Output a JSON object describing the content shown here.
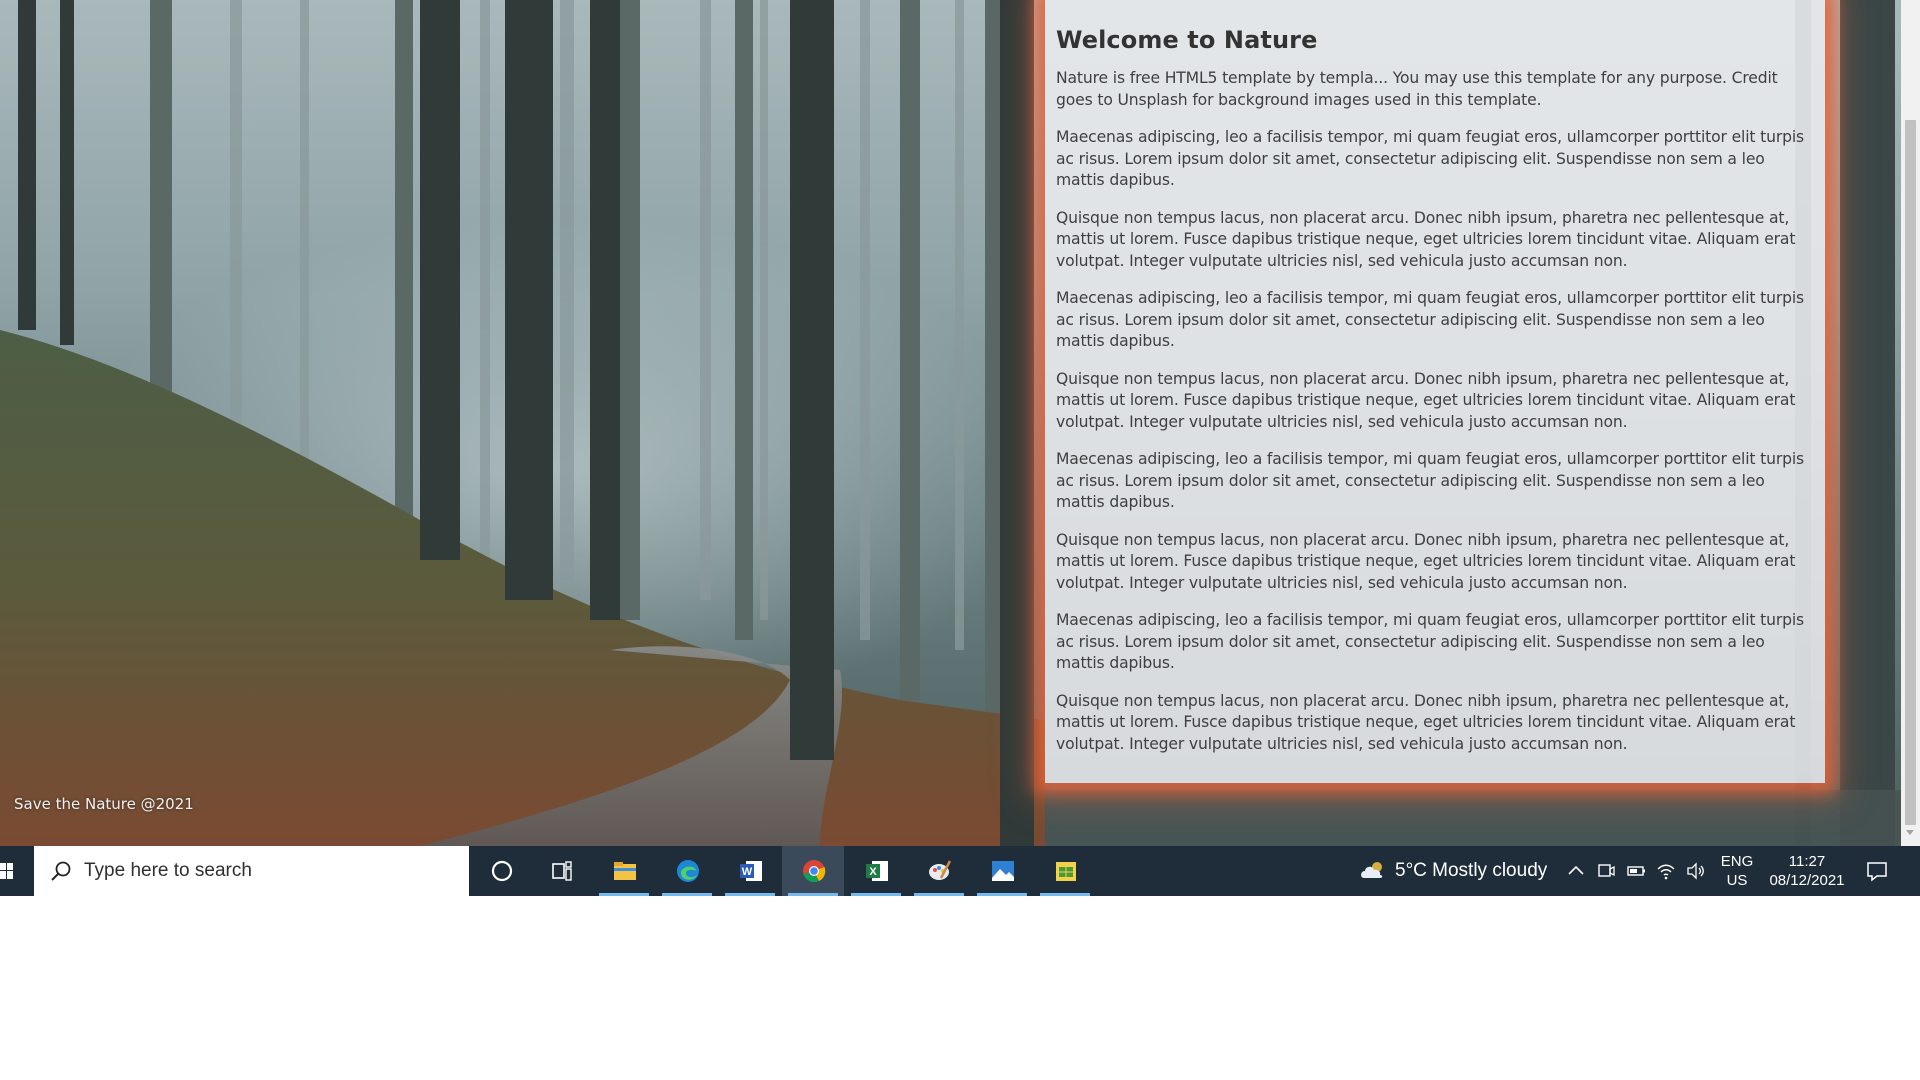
{
  "page": {
    "title": "Welcome to Nature",
    "paragraphs": [
      "Nature is free HTML5 template by templa... You may use this template for any purpose. Credit goes to Unsplash for background images used in this template.",
      "Maecenas adipiscing, leo a facilisis tempor, mi quam feugiat eros, ullamcorper porttitor elit turpis ac risus. Lorem ipsum dolor sit amet, consectetur adipiscing elit. Suspendisse non sem a leo mattis dapibus.",
      "Quisque non tempus lacus, non placerat arcu. Donec nibh ipsum, pharetra nec pellentesque at, mattis ut lorem. Fusce dapibus tristique neque, eget ultricies lorem tincidunt vitae. Aliquam erat volutpat. Integer vulputate ultricies nisl, sed vehicula justo accumsan non.",
      "Maecenas adipiscing, leo a facilisis tempor, mi quam feugiat eros, ullamcorper porttitor elit turpis ac risus. Lorem ipsum dolor sit amet, consectetur adipiscing elit. Suspendisse non sem a leo mattis dapibus.",
      "Quisque non tempus lacus, non placerat arcu. Donec nibh ipsum, pharetra nec pellentesque at, mattis ut lorem. Fusce dapibus tristique neque, eget ultricies lorem tincidunt vitae. Aliquam erat volutpat. Integer vulputate ultricies nisl, sed vehicula justo accumsan non.",
      "Maecenas adipiscing, leo a facilisis tempor, mi quam feugiat eros, ullamcorper porttitor elit turpis ac risus. Lorem ipsum dolor sit amet, consectetur adipiscing elit. Suspendisse non sem a leo mattis dapibus.",
      "Quisque non tempus lacus, non placerat arcu. Donec nibh ipsum, pharetra nec pellentesque at, mattis ut lorem. Fusce dapibus tristique neque, eget ultricies lorem tincidunt vitae. Aliquam erat volutpat. Integer vulputate ultricies nisl, sed vehicula justo accumsan non.",
      "Maecenas adipiscing, leo a facilisis tempor, mi quam feugiat eros, ullamcorper porttitor elit turpis ac risus. Lorem ipsum dolor sit amet, consectetur adipiscing elit. Suspendisse non sem a leo mattis dapibus.",
      "Quisque non tempus lacus, non placerat arcu. Donec nibh ipsum, pharetra nec pellentesque at, mattis ut lorem. Fusce dapibus tristique neque, eget ultricies lorem tincidunt vitae. Aliquam erat volutpat. Integer vulputate ultricies nisl, sed vehicula justo accumsan non."
    ],
    "footer": "Save the Nature @2021",
    "panel_glow_color": "#e86034"
  },
  "taskbar": {
    "search_placeholder": "Type here to search",
    "apps": [
      {
        "name": "file-explorer-icon",
        "active": false
      },
      {
        "name": "edge-icon",
        "active": false
      },
      {
        "name": "word-icon",
        "active": false
      },
      {
        "name": "chrome-icon",
        "active": true
      },
      {
        "name": "excel-icon",
        "active": false
      },
      {
        "name": "paint-icon",
        "active": false
      },
      {
        "name": "photos-icon",
        "active": false
      },
      {
        "name": "sheet-app-icon",
        "active": false
      }
    ],
    "weather": {
      "text": "5°C  Mostly cloudy",
      "icon": "cloud-icon"
    },
    "language": {
      "line1": "ENG",
      "line2": "US"
    },
    "clock": {
      "time": "11:27",
      "date": "08/12/2021"
    },
    "accent_color": "#76b9ed",
    "background_color": "#1f2d3a"
  }
}
